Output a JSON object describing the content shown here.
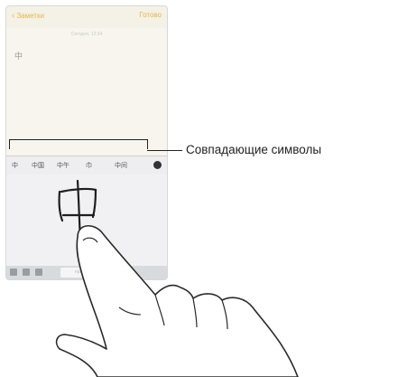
{
  "nav": {
    "back_label": "Заметки",
    "done_label": "Готово"
  },
  "note": {
    "date": "Сегодня, 12:34",
    "typed_char": "中"
  },
  "candidates": [
    "中",
    "中国",
    "中午",
    "巾",
    "中间"
  ],
  "keyboard": {
    "space_label": "пробел"
  },
  "callout": {
    "label": "Совпадающие символы"
  },
  "colors": {
    "accent": "#e5b84a",
    "screen_bg": "#f7f5ee",
    "candidate_bar": "#eeeef0",
    "handwriting_bg": "#f1f1f3"
  }
}
